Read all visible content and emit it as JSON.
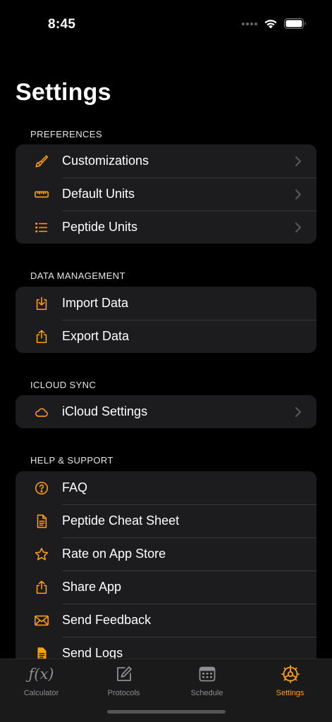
{
  "status_bar": {
    "time": "8:45"
  },
  "title": "Settings",
  "colors": {
    "accent": "#ff9f0a",
    "group_bg": "#1c1c1e",
    "background": "#000000",
    "separator": "#38383a"
  },
  "sections": {
    "preferences": {
      "header": "PREFERENCES",
      "items": [
        {
          "label": "Customizations",
          "icon": "paintbrush-icon"
        },
        {
          "label": "Default Units",
          "icon": "ruler-icon"
        },
        {
          "label": "Peptide Units",
          "icon": "list-icon"
        }
      ]
    },
    "data_management": {
      "header": "DATA MANAGEMENT",
      "items": [
        {
          "label": "Import Data",
          "icon": "tray-download-icon"
        },
        {
          "label": "Export Data",
          "icon": "share-upload-icon"
        }
      ]
    },
    "icloud_sync": {
      "header": "ICLOUD SYNC",
      "items": [
        {
          "label": "iCloud Settings",
          "icon": "cloud-icon"
        }
      ]
    },
    "help_support": {
      "header": "HELP & SUPPORT",
      "items": [
        {
          "label": "FAQ",
          "icon": "question-circle-icon"
        },
        {
          "label": "Peptide Cheat Sheet",
          "icon": "document-icon"
        },
        {
          "label": "Rate on App Store",
          "icon": "star-icon"
        },
        {
          "label": "Share App",
          "icon": "share-icon"
        },
        {
          "label": "Send Feedback",
          "icon": "envelope-icon"
        },
        {
          "label": "Send Logs",
          "icon": "document-filled-icon"
        }
      ]
    }
  },
  "tab_bar": {
    "calculator": {
      "label": "Calculator",
      "glyph": "ƒ(x)"
    },
    "protocols": {
      "label": "Protocols"
    },
    "schedule": {
      "label": "Schedule"
    },
    "settings": {
      "label": "Settings"
    }
  }
}
